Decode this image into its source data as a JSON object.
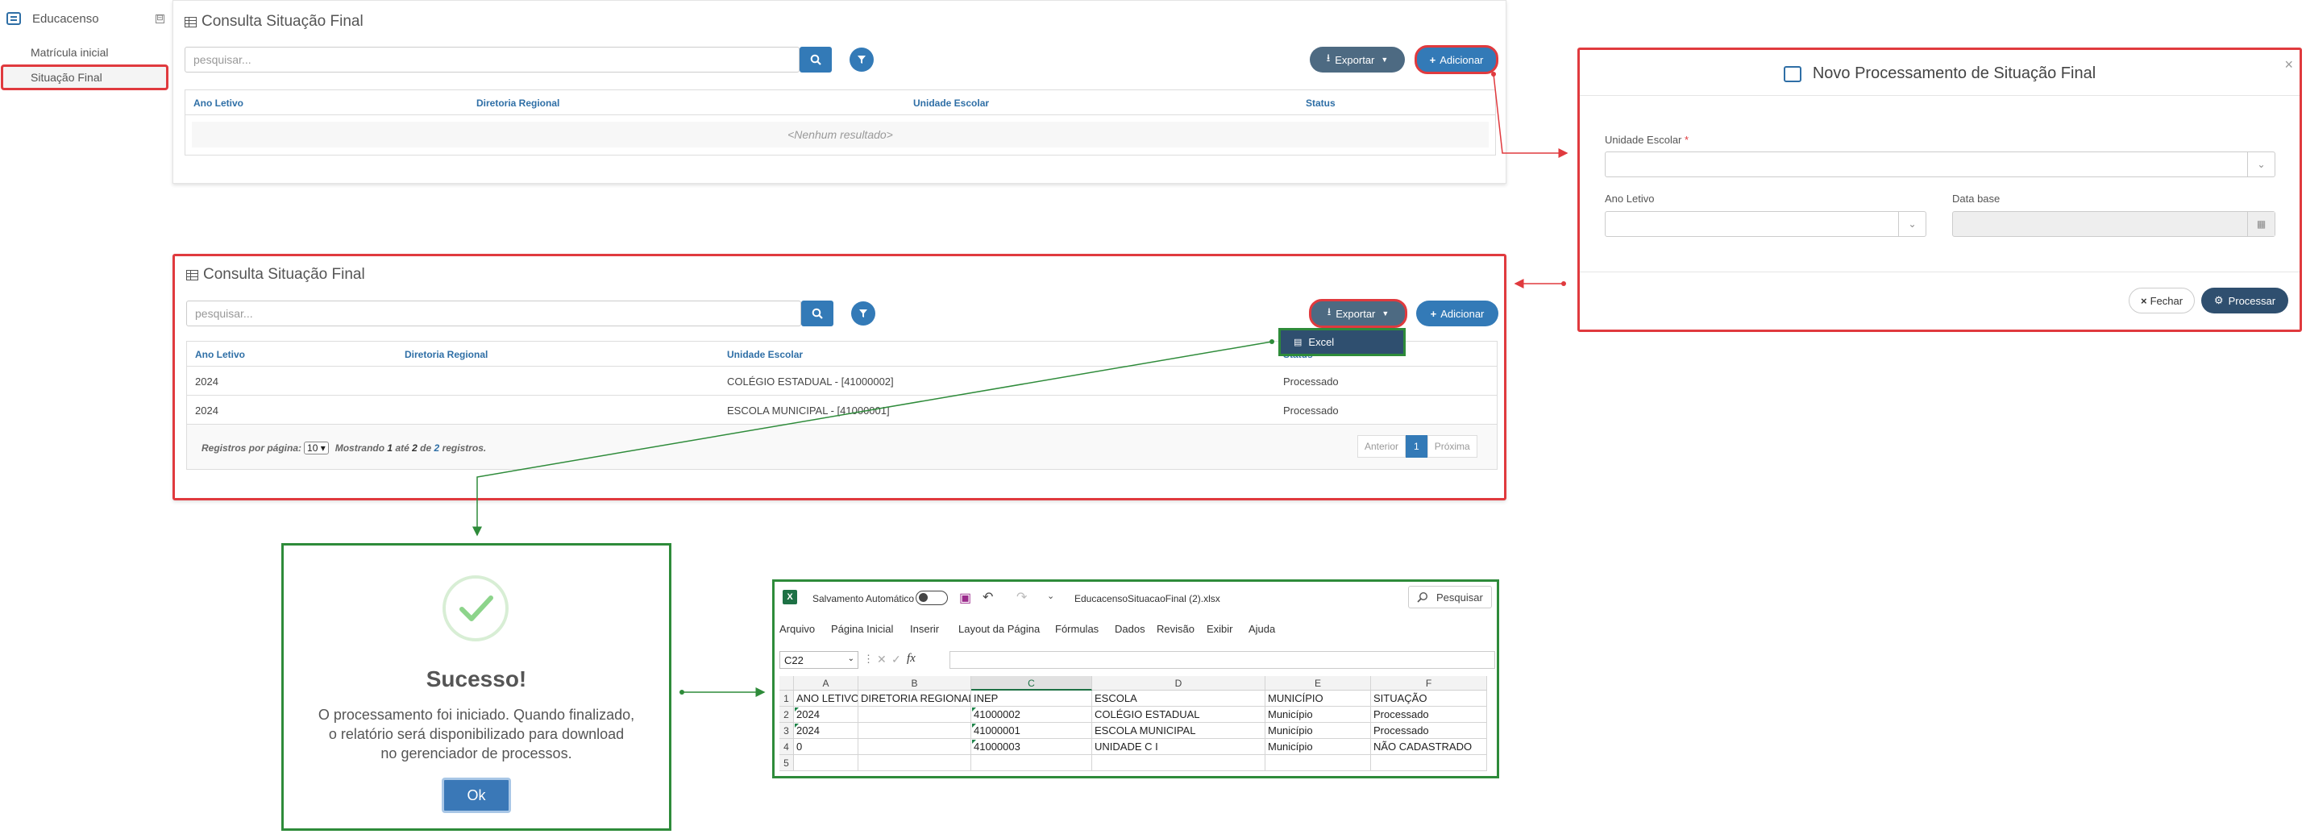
{
  "sidebar": {
    "app_name": "Educacenso",
    "collapse_symbol": "⊟",
    "items": [
      {
        "label": "Matrícula inicial"
      },
      {
        "label": "Situação Final"
      }
    ]
  },
  "panel_top": {
    "title": "Consulta Situação Final",
    "search_placeholder": "pesquisar...",
    "export_label": "Exportar",
    "add_label": "Adicionar",
    "columns": [
      "Ano Letivo",
      "Diretoria Regional",
      "Unidade Escolar",
      "Status"
    ],
    "empty_text": "<Nenhum resultado>"
  },
  "panel_bottom": {
    "title": "Consulta Situação Final",
    "search_placeholder": "pesquisar...",
    "export_label": "Exportar",
    "add_label": "Adicionar",
    "export_menu": [
      "Excel"
    ],
    "columns": [
      "Ano Letivo",
      "Diretoria Regional",
      "Unidade Escolar",
      "Status"
    ],
    "rows": [
      {
        "ano": "2024",
        "diretoria": "",
        "unidade": "COLÉGIO ESTADUAL - [41000002]",
        "status": "Processado"
      },
      {
        "ano": "2024",
        "diretoria": "",
        "unidade": "ESCOLA MUNICIPAL - [41000001]",
        "status": "Processado"
      }
    ],
    "footer": {
      "per_page_label": "Registros por página:",
      "per_page_value": "10",
      "showing_prefix": "Mostrando",
      "showing_from": "1",
      "showing_to_label": "até",
      "showing_to": "2",
      "showing_of_label": "de",
      "showing_total": "2",
      "showing_suffix": "registros.",
      "prev_label": "Anterior",
      "page": "1",
      "next_label": "Próxima"
    }
  },
  "modal": {
    "title": "Novo Processamento de Situação Final",
    "close_symbol": "×",
    "unidade_label": "Unidade Escolar",
    "required_mark": "*",
    "ano_label": "Ano Letivo",
    "data_base_label": "Data base",
    "close_button": "Fechar",
    "process_button": "Processar"
  },
  "success_dialog": {
    "title": "Sucesso!",
    "message_line1": "O processamento foi iniciado. Quando finalizado,",
    "message_line2": "o relatório será disponibilizado para download",
    "message_line3": "no gerenciador de processos.",
    "ok_label": "Ok"
  },
  "excel": {
    "autosave_label": "Salvamento Automático",
    "filename": "EducacensoSituacaoFinal (2).xlsx",
    "search_label": "Pesquisar",
    "menu": [
      "Arquivo",
      "Página Inicial",
      "Inserir",
      "Layout da Página",
      "Fórmulas",
      "Dados",
      "Revisão",
      "Exibir",
      "Ajuda"
    ],
    "name_box": "C22",
    "fx_label": "fx",
    "columns": [
      "A",
      "B",
      "C",
      "D",
      "E",
      "F"
    ],
    "rows": [
      {
        "n": "1",
        "cells": [
          "ANO LETIVO",
          "DIRETORIA REGIONAL",
          "INEP",
          "ESCOLA",
          "MUNICÍPIO",
          "SITUAÇÃO"
        ]
      },
      {
        "n": "2",
        "cells": [
          "2024",
          "",
          "41000002",
          "COLÉGIO ESTADUAL",
          "Município",
          "Processado"
        ]
      },
      {
        "n": "3",
        "cells": [
          "2024",
          "",
          "41000001",
          "ESCOLA MUNICIPAL",
          "Município",
          "Processado"
        ]
      },
      {
        "n": "4",
        "cells": [
          "0",
          "",
          "41000003",
          "UNIDADE C I",
          "Município",
          "NÃO CADASTRADO"
        ]
      },
      {
        "n": "5",
        "cells": [
          "",
          "",
          "",
          "",
          "",
          ""
        ]
      }
    ]
  },
  "colors": {
    "highlight_red": "#e03a3e",
    "highlight_green": "#2e8b3a",
    "primary_blue": "#337ab7",
    "export_slate": "#4d6a82",
    "process_navy": "#2f4f6f"
  }
}
